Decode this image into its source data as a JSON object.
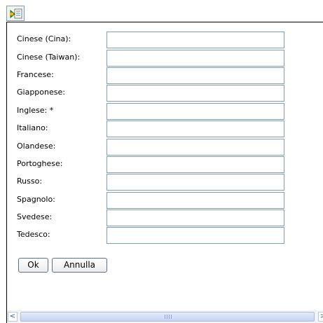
{
  "toolbar": {
    "icon": "translate-icon"
  },
  "form": {
    "fields": [
      {
        "label": "Cinese (Cina):",
        "value": ""
      },
      {
        "label": "Cinese (Taiwan):",
        "value": ""
      },
      {
        "label": "Francese:",
        "value": ""
      },
      {
        "label": "Giapponese:",
        "value": ""
      },
      {
        "label": "Inglese: *",
        "value": ""
      },
      {
        "label": "Italiano:",
        "value": ""
      },
      {
        "label": "Olandese:",
        "value": ""
      },
      {
        "label": "Portoghese:",
        "value": ""
      },
      {
        "label": "Russo:",
        "value": ""
      },
      {
        "label": "Spagnolo:",
        "value": ""
      },
      {
        "label": "Svedese:",
        "value": ""
      },
      {
        "label": "Tedesco:",
        "value": ""
      }
    ]
  },
  "buttons": {
    "ok_label": "Ok",
    "cancel_label": "Annulla"
  },
  "scrollbar": {
    "left_arrow": "<",
    "right_arrow": ">"
  },
  "colors": {
    "input_border": "#7f9db9",
    "scroll_thumb": "#c5d4f5",
    "scroll_arrow": "#2e5395"
  }
}
